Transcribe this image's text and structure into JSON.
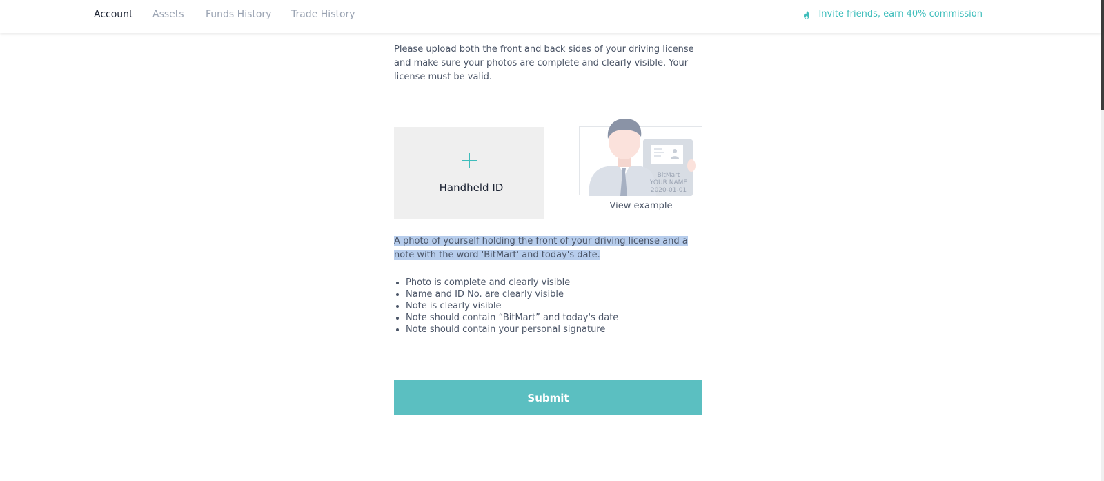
{
  "nav": {
    "tabs": [
      {
        "label": "Account",
        "active": true
      },
      {
        "label": "Assets",
        "active": false
      },
      {
        "label": "Funds History",
        "active": false
      },
      {
        "label": "Trade History",
        "active": false
      }
    ],
    "invite": {
      "label": "Invite friends, earn 40% commission",
      "icon": "flame-icon"
    }
  },
  "main": {
    "intro": "Please upload both the front and back sides of your driving license and make sure your photos are complete and clearly visible. Your license must be valid.",
    "upload": {
      "label": "Handheld ID",
      "icon": "plus-icon"
    },
    "example": {
      "card_brand": "BitMart",
      "card_name": "YOUR NAME",
      "card_date": "2020-01-01",
      "link": "View example"
    },
    "description": "A photo of yourself holding the front of your driving license and a note with the word 'BitMart' and today's date.",
    "requirements": [
      "Photo is complete and clearly visible",
      "Name and ID No. are clearly visible",
      "Note is clearly visible",
      "Note should contain “BitMart” and today's date",
      "Note should contain your personal signature"
    ],
    "submit_label": "Submit"
  },
  "colors": {
    "accent": "#3ebdbb",
    "button": "#5bbfc1",
    "text_selection": "#b7cdec"
  }
}
